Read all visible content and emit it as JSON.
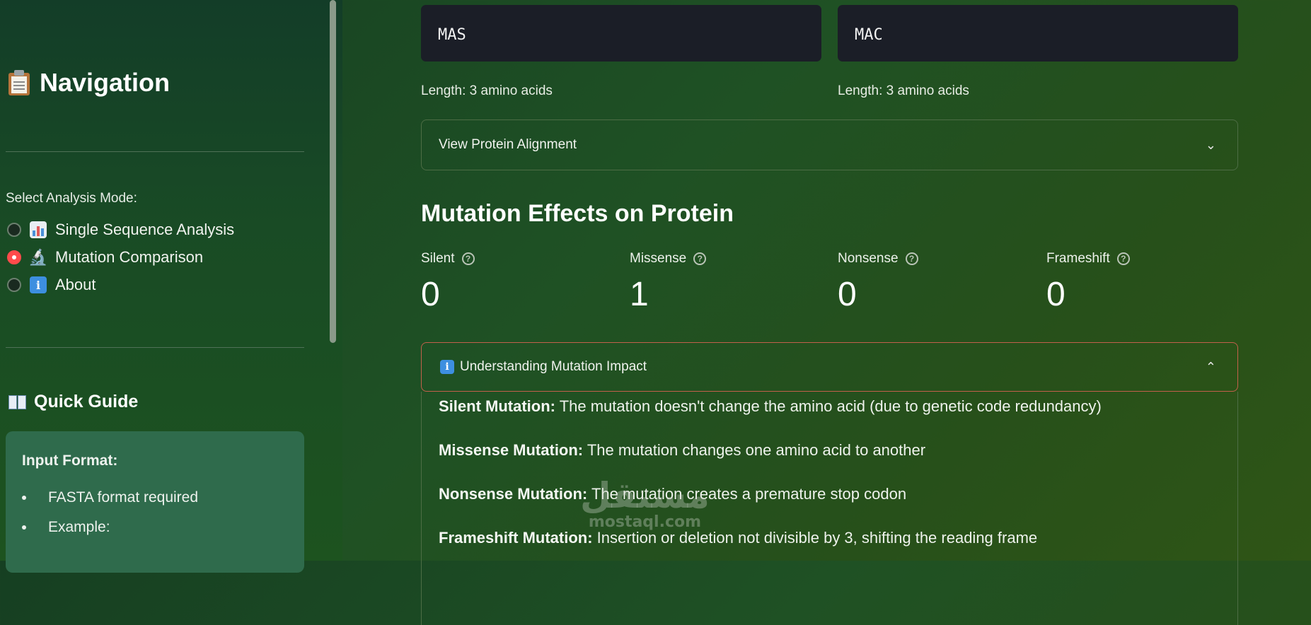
{
  "sidebar": {
    "title": "Navigation",
    "title_icon": "clipboard-icon",
    "mode_label": "Select Analysis Mode:",
    "modes": [
      {
        "label": "Single Sequence Analysis",
        "icon": "bar-chart-icon",
        "selected": false
      },
      {
        "label": "Mutation Comparison",
        "icon": "microscope-icon",
        "selected": true
      },
      {
        "label": "About",
        "icon": "info-icon",
        "selected": false
      }
    ],
    "guide_title": "Quick Guide",
    "guide_icon": "open-book-icon",
    "guide_heading": "Input Format:",
    "guide_items": [
      "FASTA format required",
      "Example:"
    ]
  },
  "main": {
    "sequences": [
      {
        "value": "MAS",
        "length_text": "Length: 3 amino acids"
      },
      {
        "value": "MAC",
        "length_text": "Length: 3 amino acids"
      }
    ],
    "alignment_expander": "View Protein Alignment",
    "section_title": "Mutation Effects on Protein",
    "metrics": [
      {
        "label": "Silent",
        "value": "0"
      },
      {
        "label": "Missense",
        "value": "1"
      },
      {
        "label": "Nonsense",
        "value": "0"
      },
      {
        "label": "Frameshift",
        "value": "0"
      }
    ],
    "impact": {
      "title": "Understanding Mutation Impact",
      "items": [
        {
          "term": "Silent Mutation:",
          "text": " The mutation doesn't change the amino acid (due to genetic code redundancy)"
        },
        {
          "term": "Missense Mutation:",
          "text": " The mutation changes one amino acid to another"
        },
        {
          "term": "Nonsense Mutation:",
          "text": " The mutation creates a premature stop codon"
        },
        {
          "term": "Frameshift Mutation:",
          "text": " Insertion or deletion not divisible by 3, shifting the reading frame"
        }
      ]
    }
  },
  "watermark": {
    "arabic": "مستقل",
    "latin": "mostaql.com"
  },
  "colors": {
    "accent": "#ff4b4b",
    "impact_border": "#c2604b",
    "background": "#1f5124"
  }
}
